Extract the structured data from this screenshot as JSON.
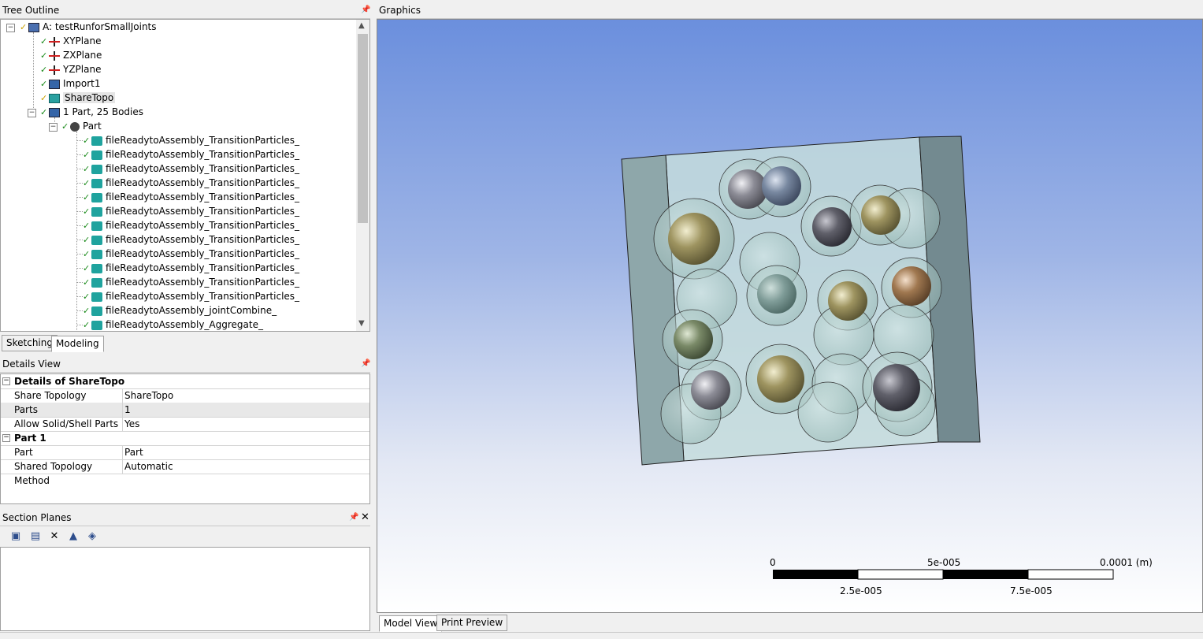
{
  "panels": {
    "tree_outline": {
      "title": "Tree Outline"
    },
    "details_view": {
      "title": "Details View"
    },
    "section_planes": {
      "title": "Section Planes"
    },
    "graphics": {
      "title": "Graphics"
    }
  },
  "tree": {
    "root": "A: testRunforSmallJoints",
    "planes": [
      "XYPlane",
      "ZXPlane",
      "YZPlane"
    ],
    "import": "Import1",
    "sharetopo": "ShareTopo",
    "parts_node": "1 Part, 25 Bodies",
    "part": "Part",
    "bodies": [
      "fileReadytoAssembly_TransitionParticles_",
      "fileReadytoAssembly_TransitionParticles_",
      "fileReadytoAssembly_TransitionParticles_",
      "fileReadytoAssembly_TransitionParticles_",
      "fileReadytoAssembly_TransitionParticles_",
      "fileReadytoAssembly_TransitionParticles_",
      "fileReadytoAssembly_TransitionParticles_",
      "fileReadytoAssembly_TransitionParticles_",
      "fileReadytoAssembly_TransitionParticles_",
      "fileReadytoAssembly_TransitionParticles_",
      "fileReadytoAssembly_TransitionParticles_",
      "fileReadytoAssembly_TransitionParticles_",
      "fileReadytoAssembly_jointCombine_",
      "fileReadytoAssembly_Aggregate_"
    ]
  },
  "tabs": {
    "sketching": "Sketching",
    "modeling": "Modeling"
  },
  "details": {
    "group1": "Details of ShareTopo",
    "rows1": [
      {
        "k": "Share Topology",
        "v": "ShareTopo"
      },
      {
        "k": "Parts",
        "v": "1"
      },
      {
        "k": "Allow Solid/Shell Parts",
        "v": "Yes"
      }
    ],
    "group2": "Part 1",
    "rows2": [
      {
        "k": "Part",
        "v": "Part"
      },
      {
        "k": "Shared Topology Method",
        "v": "Automatic"
      }
    ]
  },
  "scale": {
    "l0": "0",
    "l1": "5e-005",
    "l2": "0.0001 (m)",
    "l3": "2.5e-005",
    "l4": "7.5e-005"
  },
  "bottom_tabs": {
    "model_view": "Model View",
    "print_preview": "Print Preview"
  },
  "icons": {
    "pin": "pin-icon",
    "close": "close-icon"
  },
  "colors": {
    "check": "#1a8a1a",
    "body_icon": "#1fa39e"
  }
}
